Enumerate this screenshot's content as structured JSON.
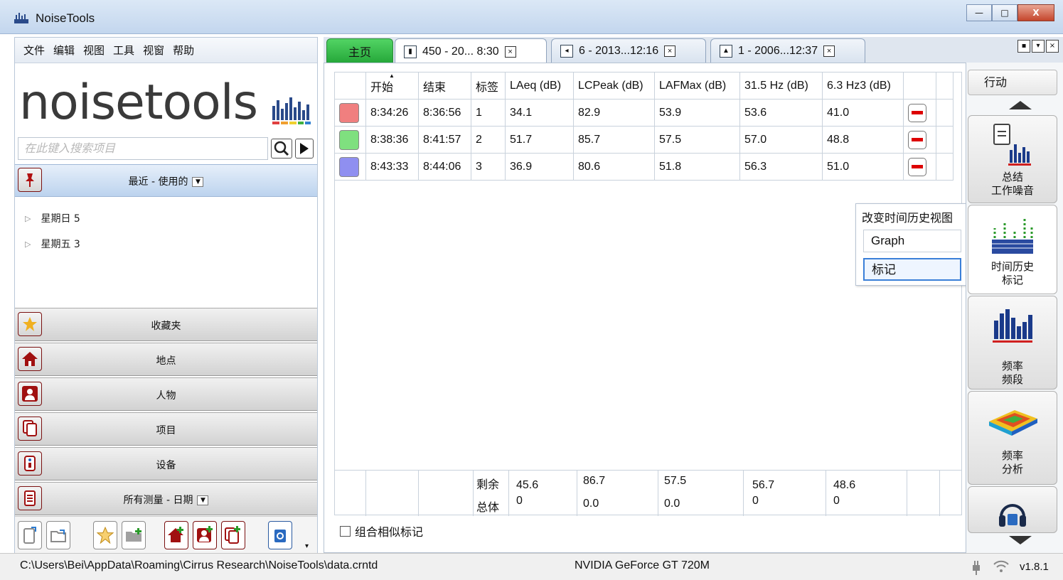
{
  "window": {
    "title": "NoiseTools",
    "minimize": "—",
    "maximize": "□",
    "close": "X"
  },
  "menu": [
    "文件",
    "编辑",
    "视图",
    "工具",
    "视窗",
    "帮助"
  ],
  "logo_text": "noisetools",
  "search": {
    "placeholder": "在此键入搜索项目"
  },
  "recent": {
    "label": "最近 - 使用的"
  },
  "tree": [
    {
      "label": "星期日 5"
    },
    {
      "label": "星期五 3"
    }
  ],
  "categories": [
    {
      "label": "收藏夹",
      "icon": "star-icon"
    },
    {
      "label": "地点",
      "icon": "house-icon"
    },
    {
      "label": "人物",
      "icon": "person-icon"
    },
    {
      "label": "项目",
      "icon": "documents-icon"
    },
    {
      "label": "设备",
      "icon": "device-icon"
    },
    {
      "label": "所有测量 - 日期",
      "icon": "document-icon"
    }
  ],
  "tabs": [
    {
      "label": "主页"
    },
    {
      "label": "450 - 20... 8:30"
    },
    {
      "label": "6 - 2013...12:16"
    },
    {
      "label": "1 - 2006...12:37"
    }
  ],
  "table": {
    "headers": [
      "开始",
      "结束",
      "标签",
      "LAeq (dB)",
      "LCPeak (dB)",
      "LAFMax (dB)",
      "31.5 Hz (dB)",
      "6.3 Hz3 (dB)"
    ],
    "rows": [
      {
        "color": "#f07f7f",
        "start": "8:34:26",
        "end": "8:36:56",
        "tag": "1",
        "laeq": "34.1",
        "lcpeak": "82.9",
        "lafmax": "53.9",
        "hz315": "53.6",
        "hz63": "41.0"
      },
      {
        "color": "#7fe07f",
        "start": "8:38:36",
        "end": "8:41:57",
        "tag": "2",
        "laeq": "51.7",
        "lcpeak": "85.7",
        "lafmax": "57.5",
        "hz315": "57.0",
        "hz63": "48.8"
      },
      {
        "color": "#8f8ff0",
        "start": "8:43:33",
        "end": "8:44:06",
        "tag": "3",
        "laeq": "36.9",
        "lcpeak": "80.6",
        "lafmax": "51.8",
        "hz315": "56.3",
        "hz63": "51.0"
      }
    ],
    "totals": {
      "label1": "剩余",
      "label2": "总体",
      "laeq": "45.6",
      "laeq2": "0",
      "lcpeak": "86.7",
      "lcpeak2": "0.0",
      "lafmax": "57.5",
      "lafmax2": "0.0",
      "hz315": "56.7",
      "hz3152": "0",
      "hz63": "48.6",
      "hz632": "0"
    }
  },
  "group_similar": "组合相似标记",
  "popup": {
    "title": "改变时间历史视图",
    "options": [
      "Graph",
      "标记"
    ]
  },
  "right": {
    "action": "行动",
    "tiles": [
      {
        "line1": "总结",
        "line2": "工作噪音"
      },
      {
        "line1": "时间历史",
        "line2": "标记"
      },
      {
        "line1": "频率",
        "line2": "频段"
      },
      {
        "line1": "频率",
        "line2": "分析"
      }
    ]
  },
  "status": {
    "path": "C:\\Users\\Bei\\AppData\\Roaming\\Cirrus Research\\NoiseTools\\data.crntd",
    "gpu": "NVIDIA GeForce GT 720M",
    "version": "v1.8.1"
  }
}
